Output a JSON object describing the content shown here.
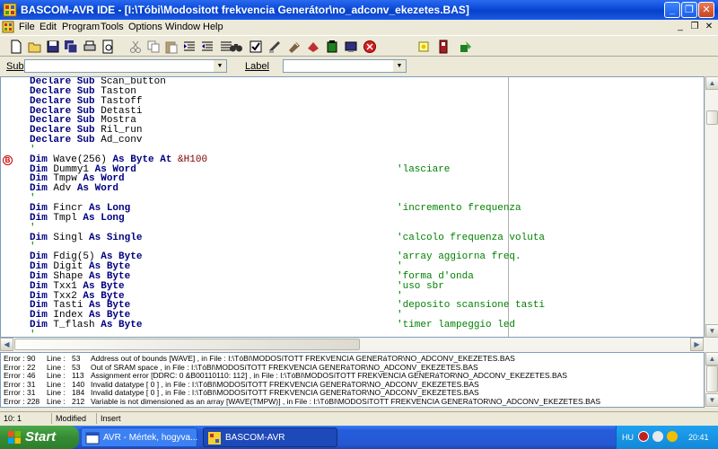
{
  "window": {
    "title": "BASCOM-AVR IDE - [I:\\Tóbi\\Modositott frekvencia Generátor\\no_adconv_ekezetes.BAS]",
    "min_glyph": "_",
    "max_glyph": "❐",
    "close_glyph": "✕"
  },
  "menu": [
    "File",
    "Edit",
    "Program",
    "Tools",
    "Options",
    "Window",
    "Help"
  ],
  "mdi": {
    "min": "_",
    "restore": "❐",
    "close": "✕"
  },
  "subrow": {
    "sub_label": "Sub",
    "label_label": "Label",
    "sub_value": "",
    "label_value": ""
  },
  "editor": {
    "lines": [
      {
        "kw1": "Declare Sub",
        "name": " Scan_button",
        "comment": ""
      },
      {
        "kw1": "Declare Sub",
        "name": " Taston",
        "comment": ""
      },
      {
        "kw1": "Declare Sub",
        "name": " Tastoff",
        "comment": ""
      },
      {
        "kw1": "Declare Sub",
        "name": " Detasti",
        "comment": ""
      },
      {
        "kw1": "Declare Sub",
        "name": " Mostra",
        "comment": ""
      },
      {
        "kw1": "Declare Sub",
        "name": " Ril_run",
        "comment": ""
      },
      {
        "kw1": "Declare Sub",
        "name": " Ad_conv",
        "comment": ""
      },
      {
        "kw1": "",
        "name": "'",
        "comment": "",
        "raw_comment": true
      },
      {
        "kw1": "Dim",
        "name": " Wave(256) ",
        "kw2": "As Byte At",
        "tail": " &H100",
        "comment": ""
      },
      {
        "kw1": "Dim",
        "name": " Dummy1 ",
        "kw2": "As Word",
        "comment": "'lasciare"
      },
      {
        "kw1": "Dim",
        "name": " Tmpw ",
        "kw2": "As Word",
        "comment": ""
      },
      {
        "kw1": "Dim",
        "name": " Adv ",
        "kw2": "As Word",
        "comment": ""
      },
      {
        "kw1": "",
        "name": "'",
        "comment": "",
        "raw_comment": true
      },
      {
        "kw1": "Dim",
        "name": " Fincr ",
        "kw2": "As Long",
        "comment": "'incremento frequenza"
      },
      {
        "kw1": "Dim",
        "name": " Tmpl ",
        "kw2": "As Long",
        "comment": ""
      },
      {
        "kw1": "",
        "name": "'",
        "comment": "",
        "raw_comment": true
      },
      {
        "kw1": "Dim",
        "name": " Singl ",
        "kw2": "As Single",
        "comment": "'calcolo frequenza voluta"
      },
      {
        "kw1": "",
        "name": "'",
        "comment": "",
        "raw_comment": true
      },
      {
        "kw1": "Dim",
        "name": " Fdig(5) ",
        "kw2": "As Byte",
        "comment": "'array aggiorna freq."
      },
      {
        "kw1": "Dim",
        "name": " Digit ",
        "kw2": "As Byte",
        "comment": "'"
      },
      {
        "kw1": "Dim",
        "name": " Shape ",
        "kw2": "As Byte",
        "comment": "'forma d'onda"
      },
      {
        "kw1": "Dim",
        "name": " Txx1 ",
        "kw2": "As Byte",
        "comment": "'uso sbr"
      },
      {
        "kw1": "Dim",
        "name": " Txx2 ",
        "kw2": "As Byte",
        "comment": "'"
      },
      {
        "kw1": "Dim",
        "name": " Tasti ",
        "kw2": "As Byte",
        "comment": "'deposito scansione tasti"
      },
      {
        "kw1": "Dim",
        "name": " Index ",
        "kw2": "As Byte",
        "comment": "'"
      },
      {
        "kw1": "Dim",
        "name": " T_flash ",
        "kw2": "As Byte",
        "comment": "'timer lampeggio led"
      },
      {
        "kw1": "",
        "name": "'",
        "comment": "",
        "raw_comment": true
      }
    ],
    "breakpoint_glyph": "B"
  },
  "errors": [
    {
      "err": "Error : 90",
      "line": "Line :",
      "num": "53",
      "msg": "Address out of bounds [WAVE]  , in File : I:\\TóBI\\MODOSíTOTT FREKVENCIA GENERáTOR\\NO_ADCONV_EKEZETES.BAS"
    },
    {
      "err": "Error : 22",
      "line": "Line :",
      "num": "53",
      "msg": "Out of SRAM space  , in File : I:\\TóBI\\MODOSíTOTT FREKVENCIA GENERáTOR\\NO_ADCONV_EKEZETES.BAS"
    },
    {
      "err": "Error : 46",
      "line": "Line :",
      "num": "113",
      "msg": "Assignment error [DDRC: 0   &B00110110: 112]  , in File : I:\\TóBI\\MODOSíTOTT FREKVENCIA GENERáTOR\\NO_ADCONV_EKEZETES.BAS"
    },
    {
      "err": "Error : 31",
      "line": "Line :",
      "num": "140",
      "msg": "Invalid datatype [ 0 ]  , in File : I:\\TóBI\\MODOSíTOTT FREKVENCIA GENERáTOR\\NO_ADCONV_EKEZETES.BAS"
    },
    {
      "err": "Error : 31",
      "line": "Line :",
      "num": "184",
      "msg": "Invalid datatype [ 0 ]  , in File : I:\\TóBI\\MODOSíTOTT FREKVENCIA GENERáTOR\\NO_ADCONV_EKEZETES.BAS"
    },
    {
      "err": "Error : 228",
      "line": "Line :",
      "num": "212",
      "msg": "Variable is not dimensioned as an array [WAVE(TMPW)]  , in File : I:\\TóBI\\MODOSíTOTT FREKVENCIA GENERáTOR\\NO_ADCONV_EKEZETES.BAS"
    }
  ],
  "status": {
    "position": "10: 1",
    "modified": "Modified",
    "mode": "Insert"
  },
  "taskbar": {
    "start": "Start",
    "tasks": [
      "AVR - Mértek, hogyva...",
      "BASCOM-AVR"
    ],
    "lang": "HU",
    "clock": "20:41"
  },
  "colors": {
    "keyword": "#000080",
    "comment": "#008000",
    "title_blue": "#0a4ad8",
    "taskbar_blue": "#245ddb",
    "start_green": "#358c33"
  }
}
